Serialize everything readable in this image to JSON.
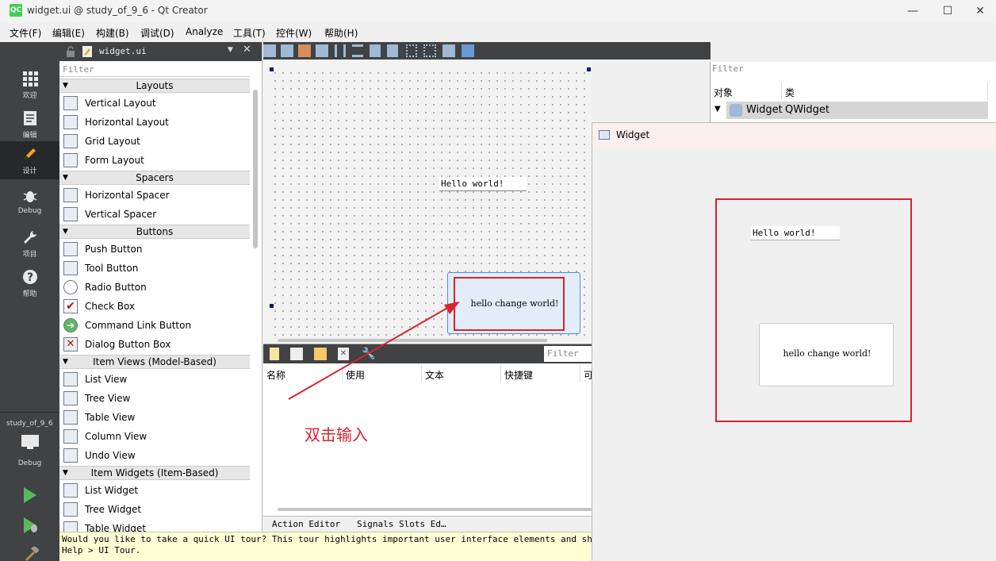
{
  "window": {
    "title": "widget.ui @ study_of_9_6 - Qt Creator",
    "app_icon": "QC"
  },
  "menu": [
    "文件(F)",
    "编辑(E)",
    "构建(B)",
    "调试(D)",
    "Analyze",
    "工具(T)",
    "控件(W)",
    "帮助(H)"
  ],
  "modes": [
    {
      "label": "欢迎",
      "icon": "grid-icon"
    },
    {
      "label": "编辑",
      "icon": "document-icon"
    },
    {
      "label": "设计",
      "icon": "pencil-icon"
    },
    {
      "label": "Debug",
      "icon": "bug-icon"
    },
    {
      "label": "项目",
      "icon": "wrench-icon"
    },
    {
      "label": "帮助",
      "icon": "help-icon"
    }
  ],
  "kit": {
    "project": "study_of_9_6",
    "mode": "Debug"
  },
  "editor_tab": {
    "file": "widget.ui"
  },
  "widget_box": {
    "filter_placeholder": "Filter",
    "categories": [
      {
        "name": "Layouts",
        "items": [
          "Vertical Layout",
          "Horizontal Layout",
          "Grid Layout",
          "Form Layout"
        ]
      },
      {
        "name": "Spacers",
        "items": [
          "Horizontal Spacer",
          "Vertical Spacer"
        ]
      },
      {
        "name": "Buttons",
        "items": [
          "Push Button",
          "Tool Button",
          "Radio Button",
          "Check Box",
          "Command Link Button",
          "Dialog Button Box"
        ]
      },
      {
        "name": "Item Views (Model-Based)",
        "items": [
          "List View",
          "Tree View",
          "Table View",
          "Column View",
          "Undo View"
        ]
      },
      {
        "name": "Item Widgets (Item-Based)",
        "items": [
          "List Widget",
          "Tree Widget",
          "Table Widget"
        ]
      }
    ]
  },
  "form": {
    "label_text": "Hello world!",
    "button_text": "hello change world!"
  },
  "action_editor": {
    "filter_placeholder": "Filter",
    "columns": [
      "名称",
      "使用",
      "文本",
      "快捷键",
      "可"
    ],
    "tabs": [
      "Action Editor",
      "Signals  Slots Ed…"
    ]
  },
  "object_inspector": {
    "filter_placeholder": "Filter",
    "columns": [
      "对象",
      "类"
    ],
    "row": {
      "object": "Widget",
      "class": "QWidget"
    }
  },
  "hint": "Would you like to take a quick UI tour? This tour highlights important user interface elements and shows how the\nHelp > UI Tour.",
  "preview": {
    "title": "Widget",
    "label_text": "Hello world!",
    "button_text": "hello change world!"
  },
  "annotation": {
    "text": "双击输入",
    "color": "#d9232d"
  }
}
